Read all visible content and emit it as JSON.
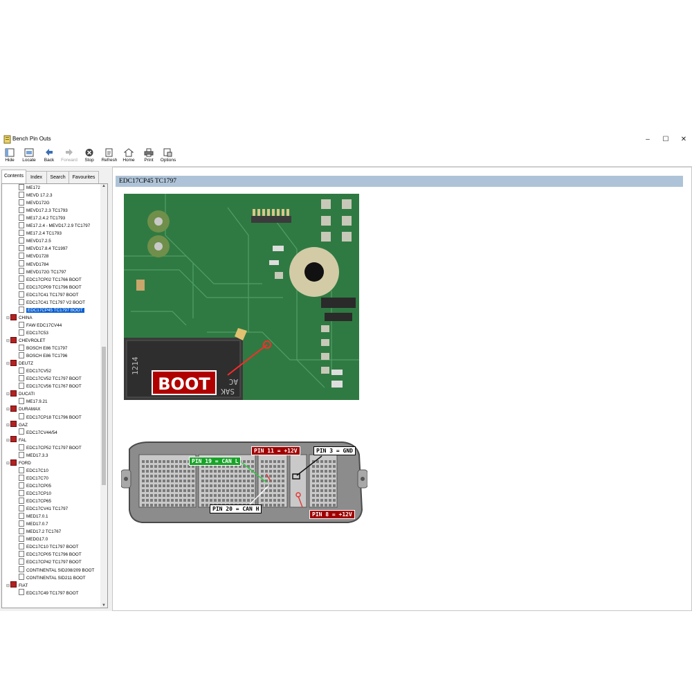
{
  "window": {
    "title": "Bench Pin Outs",
    "controls": [
      "–",
      "☐",
      "✕"
    ]
  },
  "toolbar": {
    "hide": "Hide",
    "locate": "Locate",
    "back": "Back",
    "forward": "Forward",
    "stop": "Stop",
    "refresh": "Refresh",
    "home": "Home",
    "print": "Print",
    "options": "Options"
  },
  "tabs": {
    "contents": "Contents",
    "index": "Index",
    "search": "Search",
    "favourites": "Favourites"
  },
  "tree": [
    {
      "type": "page",
      "label": "ME172"
    },
    {
      "type": "page",
      "label": "MEVD 17.2.3"
    },
    {
      "type": "page",
      "label": "MEVD172G"
    },
    {
      "type": "page",
      "label": "MEVD17.2.3 TC1793"
    },
    {
      "type": "page",
      "label": "ME17.2.4.2 TC1793"
    },
    {
      "type": "page",
      "label": "ME17.2.4 - MEVD17.2.9 TC1797"
    },
    {
      "type": "page",
      "label": "ME17.2.4 TC1793"
    },
    {
      "type": "page",
      "label": "MEVD17.2.5"
    },
    {
      "type": "page",
      "label": "MEVD17.8.4 TC1997"
    },
    {
      "type": "page",
      "label": "MEVD1728"
    },
    {
      "type": "page",
      "label": "MEVD1784"
    },
    {
      "type": "page",
      "label": "MEVD172G TC1797"
    },
    {
      "type": "page",
      "label": "EDC17CP02 TC1766 BOOT"
    },
    {
      "type": "page",
      "label": "EDC17CP09 TC1796 BOOT"
    },
    {
      "type": "page",
      "label": "EDC17C41 TC1797 BOOT"
    },
    {
      "type": "page",
      "label": "EDC17C41 TC1797 V2 BOOT"
    },
    {
      "type": "page",
      "label": "EDC17CP45 TC1797 BOOT",
      "selected": true
    },
    {
      "type": "book",
      "label": "CHINA"
    },
    {
      "type": "page",
      "label": "FAW EDC17CV44"
    },
    {
      "type": "page",
      "label": "EDC17C53"
    },
    {
      "type": "book",
      "label": "CHEVROLET"
    },
    {
      "type": "page",
      "label": "BOSCH E86 TC1797"
    },
    {
      "type": "page",
      "label": "BOSCH E86 TC1796"
    },
    {
      "type": "book",
      "label": "DEUTZ"
    },
    {
      "type": "page",
      "label": "EDC17CV52"
    },
    {
      "type": "page",
      "label": "EDC17CV52 TC1797 BOOT"
    },
    {
      "type": "page",
      "label": "EDC17CV56 TC1767 BOOT"
    },
    {
      "type": "book",
      "label": "DUCATI"
    },
    {
      "type": "page",
      "label": "ME17.9.21"
    },
    {
      "type": "book",
      "label": "DURAMAX"
    },
    {
      "type": "page",
      "label": "EDC17CP18 TC1796 BOOT"
    },
    {
      "type": "book",
      "label": "GAZ"
    },
    {
      "type": "page",
      "label": "EDC17CV44/54"
    },
    {
      "type": "book",
      "label": "FAL"
    },
    {
      "type": "page",
      "label": "EDC17CP52 TC1797 BOOT"
    },
    {
      "type": "page",
      "label": "MED17.3.3"
    },
    {
      "type": "book",
      "label": "FORD"
    },
    {
      "type": "page",
      "label": "EDC17C10"
    },
    {
      "type": "page",
      "label": "EDC17C70"
    },
    {
      "type": "page",
      "label": "EDC17CP05"
    },
    {
      "type": "page",
      "label": "EDC17CP10"
    },
    {
      "type": "page",
      "label": "EDC17CP65"
    },
    {
      "type": "page",
      "label": "EDC17CV41 TC1797"
    },
    {
      "type": "page",
      "label": "MED17.0.1"
    },
    {
      "type": "page",
      "label": "MED17.0.7"
    },
    {
      "type": "page",
      "label": "MED17.2 TC1767"
    },
    {
      "type": "page",
      "label": "MEDG17.0"
    },
    {
      "type": "page",
      "label": "EDC17C10 TC1797 BOOT"
    },
    {
      "type": "page",
      "label": "EDC17CP05 TC1796 BOOT"
    },
    {
      "type": "page",
      "label": "EDC17CP42 TC1797 BOOT"
    },
    {
      "type": "page",
      "label": "CONTINENTAL SID208/209 BOOT"
    },
    {
      "type": "page",
      "label": "CONTINENTAL SID211 BOOT"
    },
    {
      "type": "book",
      "label": "FIAT"
    },
    {
      "type": "page",
      "label": "EDC17C49 TC1797 BOOT"
    }
  ],
  "content": {
    "heading": "EDC17CP45 TC1797",
    "board_image": {
      "boot_label": "BOOT",
      "chip_text": [
        "SAK",
        "AC",
        "1214"
      ]
    },
    "connector_image": {
      "pin19": "PIN 19 = CAN L",
      "pin11": "PIN 11 = +12V",
      "pin3": "PIN 3 = GND",
      "pin20": "PIN 20 = CAN H",
      "pin8": "PIN 8 = +12V"
    }
  },
  "colors": {
    "selection": "#0a5fd0",
    "heading_bar": "#aec3d7",
    "book_icon": "#b22222",
    "pcb": "#2f7a42"
  }
}
